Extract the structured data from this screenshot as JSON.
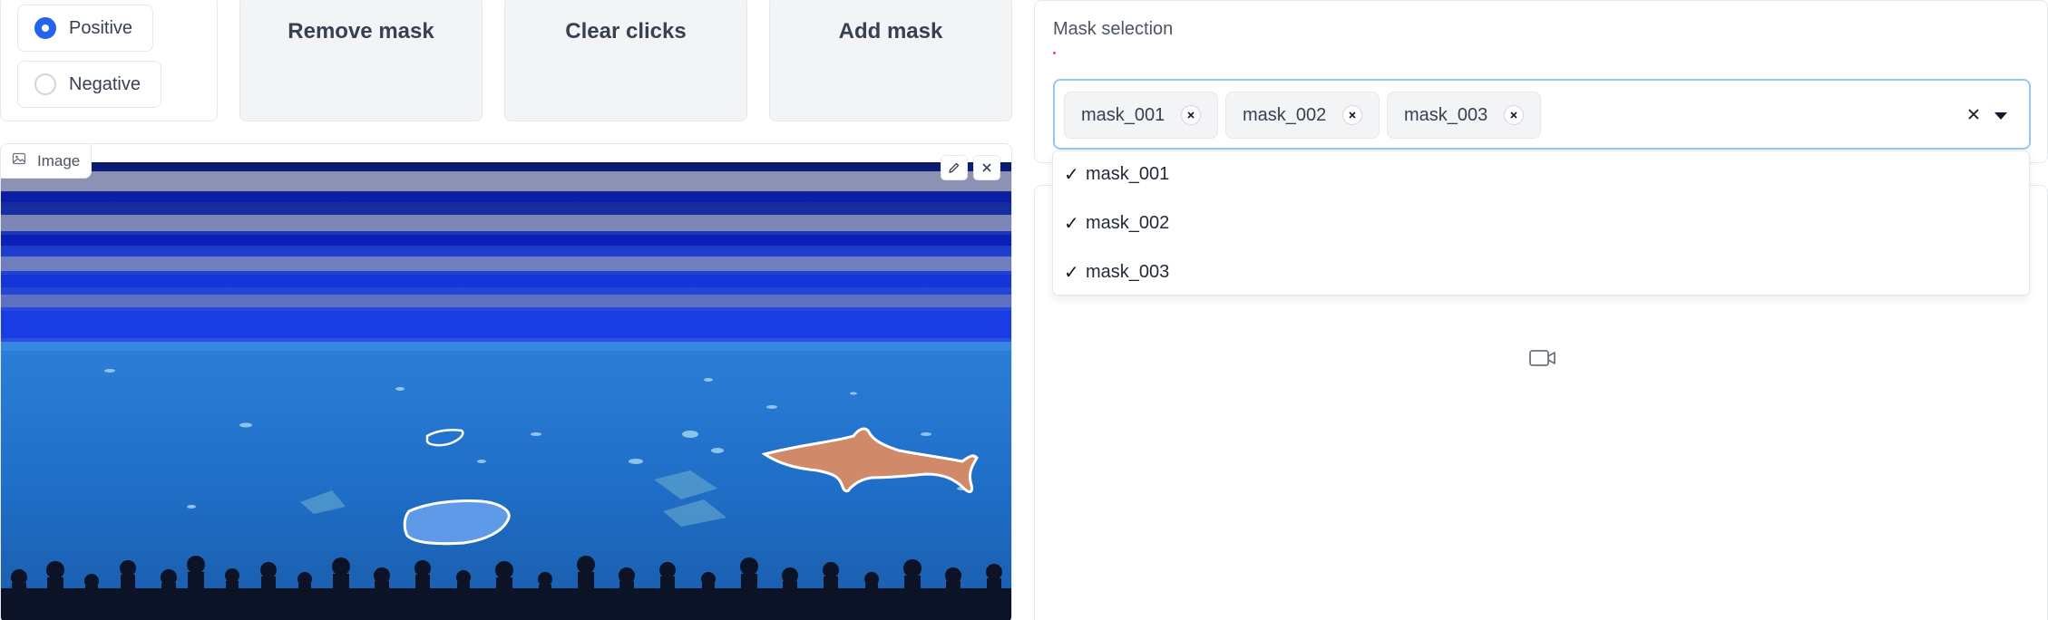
{
  "prompt_type": {
    "options": [
      {
        "label": "Positive",
        "selected": true
      },
      {
        "label": "Negative",
        "selected": false
      }
    ]
  },
  "buttons": {
    "remove_mask": "Remove mask",
    "clear_clicks": "Clear clicks",
    "add_mask": "Add mask"
  },
  "image_panel": {
    "label": "Image",
    "icons": [
      "image-icon",
      "edit-icon",
      "close-icon"
    ]
  },
  "mask_selection": {
    "label": "Mask selection",
    "selected": [
      "mask_001",
      "mask_002",
      "mask_003"
    ],
    "options": [
      {
        "label": "mask_001",
        "checked": true
      },
      {
        "label": "mask_002",
        "checked": true
      },
      {
        "label": "mask_003",
        "checked": true
      }
    ],
    "check_glyph": "✓"
  },
  "video_panel": {
    "icon": "video-camera-icon"
  },
  "colors": {
    "accent": "#2563eb",
    "focus_border": "#93c5fd",
    "button_bg": "#f3f4f6",
    "mask_fill": "#d08a6a",
    "mask_outline": "#ffffff"
  }
}
